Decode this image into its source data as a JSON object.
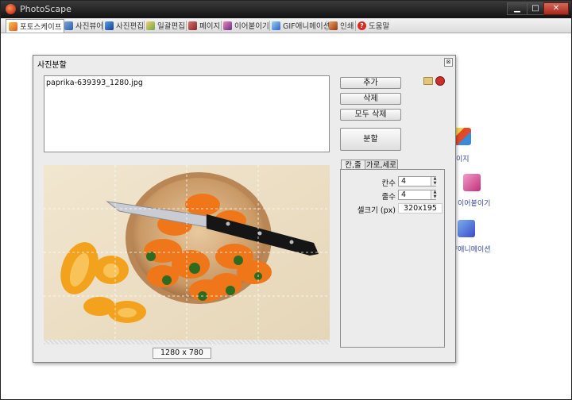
{
  "window": {
    "title": "PhotoScape",
    "min_glyph": "▁",
    "max_glyph": "□",
    "close_glyph": "✕"
  },
  "tabs": [
    {
      "label": "포토스케이프"
    },
    {
      "label": "사진뷰어"
    },
    {
      "label": "사진편집"
    },
    {
      "label": "일괄편집"
    },
    {
      "label": "페이지"
    },
    {
      "label": "이어붙이기"
    },
    {
      "label": "GIF애니메이션"
    },
    {
      "label": "인쇄"
    },
    {
      "label": "도움말"
    }
  ],
  "home": {
    "label1": "이지",
    "label2": "이어붙이기",
    "label3": "F애니메이션"
  },
  "dialog": {
    "title": "사진분할",
    "close_glyph": "⊠",
    "file_list": [
      "paprika-639393_1280.jpg"
    ],
    "buttons": {
      "add": "추가",
      "delete": "삭제",
      "delete_all": "모두 삭제",
      "split": "분할"
    },
    "image_size": "1280 x 780",
    "panel": {
      "tab1": "칸,줄",
      "tab2": "가로,세로",
      "columns_label": "칸수",
      "columns_value": "4",
      "rows_label": "줄수",
      "rows_value": "4",
      "cell_size_label": "셀크기 (px)",
      "cell_size_value": "320x195"
    }
  }
}
